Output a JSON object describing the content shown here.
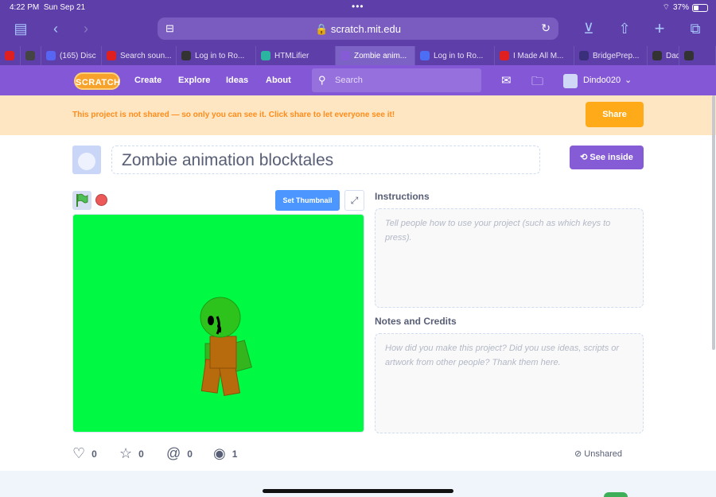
{
  "status": {
    "time": "4:22 PM",
    "date": "Sun Sep 21",
    "battery": "37%"
  },
  "browser": {
    "url": "scratch.mit.edu",
    "tabs": [
      {
        "label": "",
        "color": "#e02020"
      },
      {
        "label": "",
        "color": "#444444"
      },
      {
        "label": "(165) Disc",
        "color": "#5865f2"
      },
      {
        "label": "Search soun...",
        "color": "#e02020"
      },
      {
        "label": "Log in to Ro...",
        "color": "#333333"
      },
      {
        "label": "HTMLifier",
        "color": "#2bb5a0"
      },
      {
        "label": "Zombie anim...",
        "color": "#855cd6"
      },
      {
        "label": "Log in to Ro...",
        "color": "#4c6ef5"
      },
      {
        "label": "I Made All M...",
        "color": "#e02020"
      },
      {
        "label": "BridgePrep...",
        "color": "#3a2f7a"
      },
      {
        "label": "Dad",
        "color": "#333333"
      },
      {
        "label": "",
        "color": "#333333"
      }
    ]
  },
  "nav": {
    "logo": "SCRATCH",
    "links": [
      "Create",
      "Explore",
      "Ideas",
      "About"
    ],
    "search_placeholder": "Search",
    "username": "Dindo020"
  },
  "banner": {
    "message": "This project is not shared — so only you can see it. Click share to let everyone see it!",
    "share_label": "Share"
  },
  "project": {
    "title": "Zombie animation blocktales",
    "see_inside_label": "See inside",
    "set_thumbnail_label": "Set Thumbnail"
  },
  "instructions": {
    "heading": "Instructions",
    "placeholder": "Tell people how to use your project (such as which keys to press)."
  },
  "notes": {
    "heading": "Notes and Credits",
    "placeholder": "How did you make this project? Did you use ideas, scripts or artwork from other people? Thank them here."
  },
  "stats": {
    "loves": "0",
    "favorites": "0",
    "remixes": "0",
    "views": "1"
  },
  "share_status": "Unshared",
  "colors": {
    "accent": "#855cd6",
    "nav": "#8357d6",
    "stage_bg": "#00fa43",
    "share": "#ffab19"
  }
}
